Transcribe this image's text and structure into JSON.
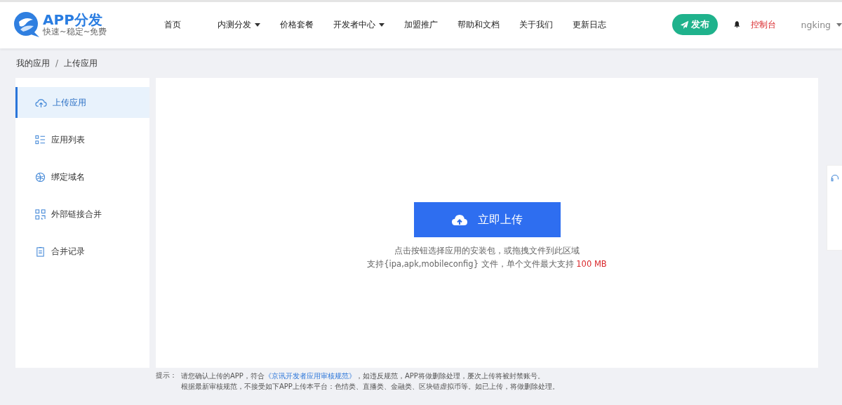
{
  "header": {
    "logo": {
      "title": "APP分发",
      "slogan": "快速~稳定~免费"
    },
    "nav": [
      {
        "label": "首页",
        "dropdown": false
      },
      {
        "label": "内测分发",
        "dropdown": true
      },
      {
        "label": "价格套餐",
        "dropdown": false
      },
      {
        "label": "开发者中心",
        "dropdown": true
      },
      {
        "label": "加盟推广",
        "dropdown": false
      },
      {
        "label": "帮助和文档",
        "dropdown": false
      },
      {
        "label": "关于我们",
        "dropdown": false
      },
      {
        "label": "更新日志",
        "dropdown": false
      }
    ],
    "publish_button": "发布",
    "console_link": "控制台",
    "user": "ngking"
  },
  "breadcrumb": {
    "items": [
      "我的应用",
      "上传应用"
    ],
    "separator": "/"
  },
  "sidebar": {
    "items": [
      {
        "label": "上传应用",
        "kind": "cloud",
        "selected": true
      },
      {
        "label": "应用列表",
        "kind": "list",
        "selected": false
      },
      {
        "label": "绑定域名",
        "kind": "globe",
        "selected": false
      },
      {
        "label": "外部链接合并",
        "kind": "grid",
        "selected": false
      },
      {
        "label": "合并记录",
        "kind": "clipboard",
        "selected": false
      }
    ]
  },
  "upload": {
    "button": "立即上传",
    "hint": "点击按钮选择应用的安装包，或拖拽文件到此区域",
    "limit": "支持{ipa,apk,mobileconfig} 文件，单个文件最大支持",
    "limit_size": "100 MB"
  },
  "tips": {
    "label": "提示：",
    "line1": {
      "before": "请您确认上传的APP，符合",
      "link": "《京讯开发者应用审核规范》",
      "after": "，如违反规范，APP将做删除处理，屡次上传将被封禁账号。"
    },
    "line2": "根据最新审核规范，不接受如下APP上传本平台：色情类、直播类、金融类、区块链虚拟币等。如已上传，将做删除处理。"
  }
}
